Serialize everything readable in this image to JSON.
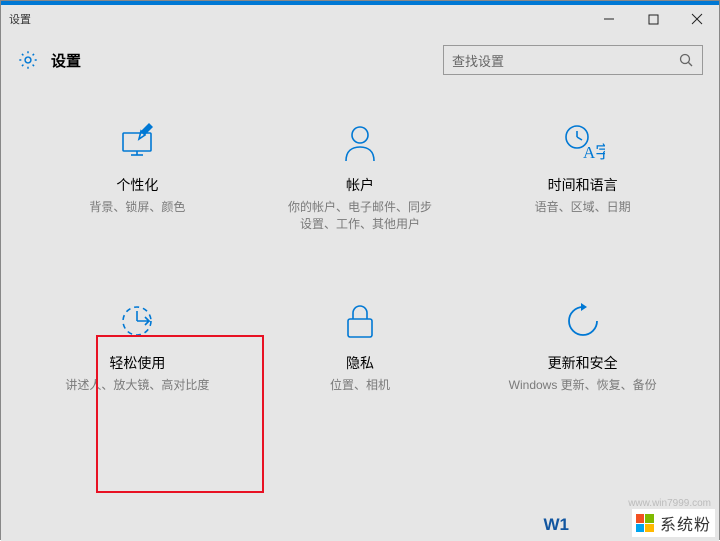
{
  "window": {
    "title": "设置"
  },
  "header": {
    "title": "设置"
  },
  "search": {
    "placeholder": "查找设置"
  },
  "tiles": [
    {
      "title": "个性化",
      "subtitle": "背景、锁屏、颜色"
    },
    {
      "title": "帐户",
      "subtitle": "你的帐户、电子邮件、同步设置、工作、其他用户"
    },
    {
      "title": "时间和语言",
      "subtitle": "语音、区域、日期"
    },
    {
      "title": "轻松使用",
      "subtitle": "讲述人、放大镜、高对比度"
    },
    {
      "title": "隐私",
      "subtitle": "位置、相机"
    },
    {
      "title": "更新和安全",
      "subtitle": "Windows 更新、恢复、备份"
    }
  ],
  "watermark": {
    "text": "系统粉",
    "url": "www.win7999.com",
    "bluetext": "W1"
  },
  "colors": {
    "accent": "#0078d4",
    "highlight": "#e81123"
  }
}
